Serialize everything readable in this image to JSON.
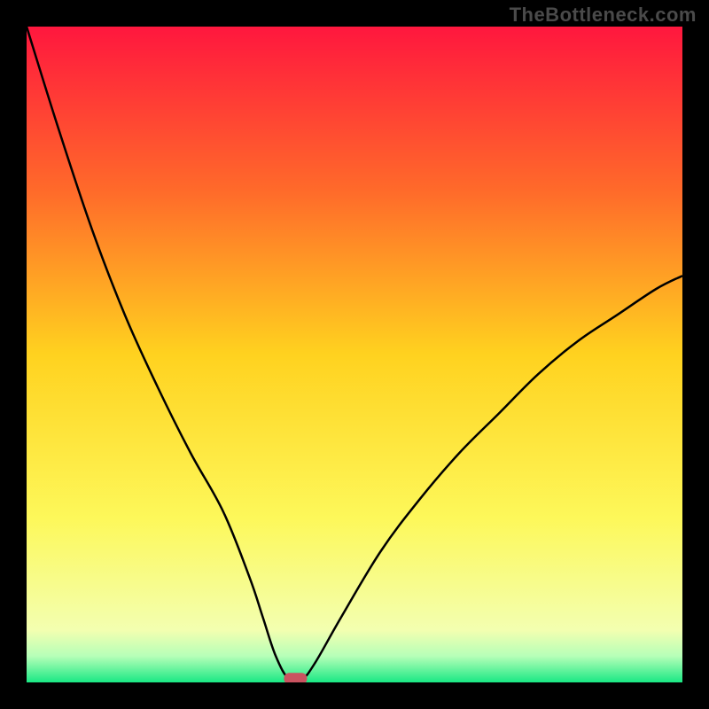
{
  "watermark": "TheBottleneck.com",
  "chart_data": {
    "type": "line",
    "title": "",
    "xlabel": "",
    "ylabel": "",
    "xlim": [
      0,
      100
    ],
    "ylim": [
      0,
      100
    ],
    "series": [
      {
        "name": "bottleneck-curve",
        "x": [
          0,
          5,
          10,
          15,
          20,
          25,
          30,
          34,
          36,
          38,
          40,
          42,
          44,
          48,
          54,
          60,
          66,
          72,
          78,
          84,
          90,
          96,
          100
        ],
        "y": [
          100,
          84,
          69,
          56,
          45,
          35,
          26,
          16,
          10,
          4,
          0.5,
          0.5,
          3,
          10,
          20,
          28,
          35,
          41,
          47,
          52,
          56,
          60,
          62
        ]
      }
    ],
    "marker": {
      "name": "optimal-point",
      "x": 41,
      "y": 0.5,
      "color": "#c95360"
    },
    "gradient_stops": [
      {
        "offset": 0,
        "color": "#ff173e"
      },
      {
        "offset": 25,
        "color": "#ff6a2a"
      },
      {
        "offset": 50,
        "color": "#ffd21f"
      },
      {
        "offset": 75,
        "color": "#fdf85a"
      },
      {
        "offset": 92,
        "color": "#f3ffb0"
      },
      {
        "offset": 96,
        "color": "#b6ffb8"
      },
      {
        "offset": 100,
        "color": "#1ae884"
      }
    ]
  }
}
